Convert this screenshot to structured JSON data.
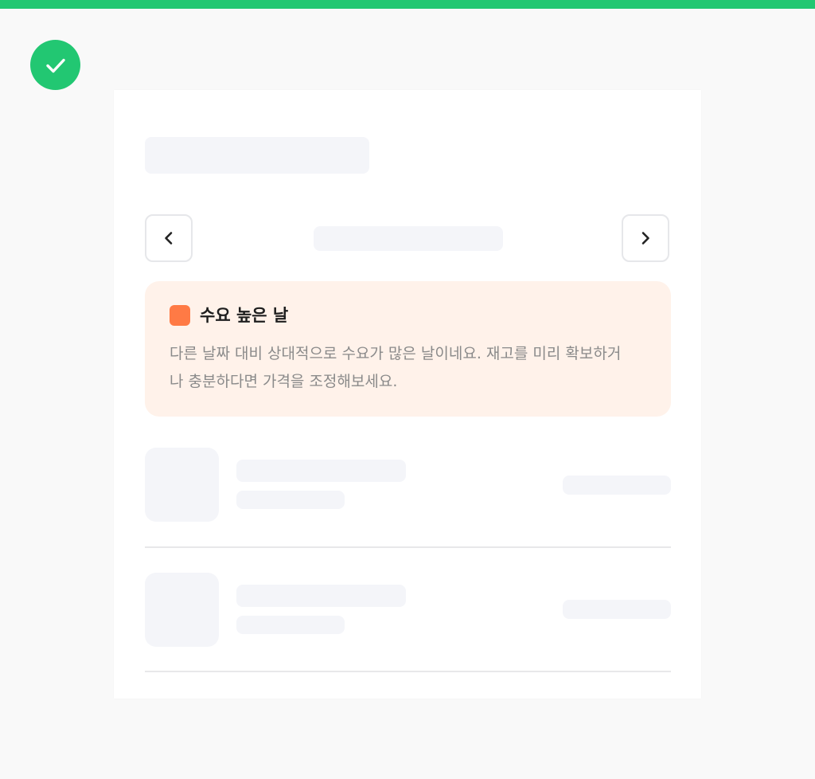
{
  "icons": {
    "status": "checkmark-icon",
    "prev": "chevron-left-icon",
    "next": "chevron-right-icon"
  },
  "colors": {
    "accent": "#22c772",
    "demand_high": "#ff7a45",
    "demand_bg": "#fff2ea",
    "skeleton": "#f4f5f9"
  },
  "demand_info": {
    "title": "수요 높은 날",
    "description": "다른 날짜 대비 상대적으로 수요가 많은 날이네요. 재고를 미리 확보하거나 충분하다면 가격을 조정해보세요."
  }
}
